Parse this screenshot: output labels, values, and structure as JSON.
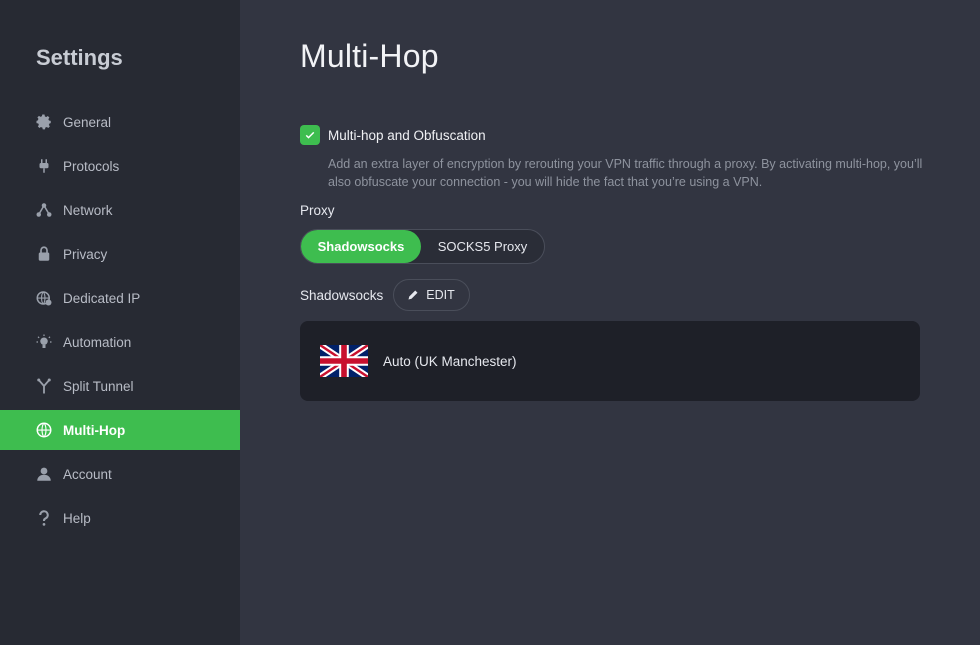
{
  "sidebar": {
    "title": "Settings",
    "items": [
      {
        "label": "General",
        "icon": "gear-icon"
      },
      {
        "label": "Protocols",
        "icon": "plug-icon"
      },
      {
        "label": "Network",
        "icon": "network-icon"
      },
      {
        "label": "Privacy",
        "icon": "lock-icon"
      },
      {
        "label": "Dedicated IP",
        "icon": "globe-ip-icon"
      },
      {
        "label": "Automation",
        "icon": "lightbulb-icon"
      },
      {
        "label": "Split Tunnel",
        "icon": "split-icon"
      },
      {
        "label": "Multi-Hop",
        "icon": "multihop-globe-icon",
        "active": true
      },
      {
        "label": "Account",
        "icon": "user-icon"
      },
      {
        "label": "Help",
        "icon": "question-icon"
      }
    ]
  },
  "main": {
    "title": "Multi-Hop",
    "multihop": {
      "label": "Multi-hop and Obfuscation",
      "checked": true,
      "description": "Add an extra layer of encryption by rerouting your VPN traffic through a proxy. By activating multi-hop, you’ll also obfuscate your connection - you will hide the fact that you’re using a VPN."
    },
    "proxy": {
      "label": "Proxy",
      "options": [
        "Shadowsocks",
        "SOCKS5 Proxy"
      ],
      "selected": "Shadowsocks"
    },
    "shadowsocks": {
      "label": "Shadowsocks",
      "edit_label": "EDIT"
    },
    "server": {
      "name": "Auto (UK Manchester)",
      "flag": "uk-flag-icon"
    }
  },
  "colors": {
    "accent": "#3ebd4f",
    "sidebar_bg": "#272a33",
    "main_bg": "#323541",
    "card_bg": "#1e2028"
  }
}
